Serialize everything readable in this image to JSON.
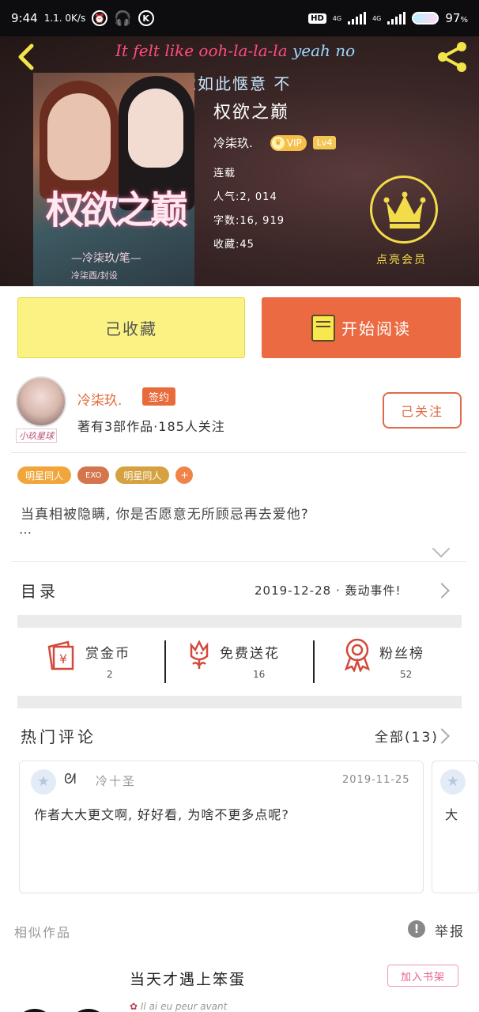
{
  "status_bar": {
    "time": "9:44",
    "net_speed": "1.1. 0K/s",
    "hd": "HD",
    "net1": "4G",
    "net2": "4G",
    "battery": "97",
    "battery_unit": "%"
  },
  "header": {
    "lyric_part1": "It felt like ooh-la-la-la ",
    "lyric_part2": "yeah no",
    "lyric_line2": "这感觉如此惬意 不",
    "book_title": "权欲之巅",
    "author_name": "冷柒玖.",
    "vip_label": "VIP",
    "level_label": "Lv4",
    "status": "连载",
    "popularity": "人气:2, 014",
    "word_count": "字数:16, 919",
    "favorites": "收藏:45",
    "member_label": "点亮会员",
    "cover": {
      "title": "权欲之巅",
      "author": "—冷柒玖/笔—",
      "designer": "冷柒酉/封设"
    }
  },
  "actions": {
    "collected_label": "己收藏",
    "read_label": "开始阅读"
  },
  "author": {
    "avatar_tag": "小玖星球",
    "name": "冷柒玖.",
    "sign_badge": "签约",
    "stats": "著有3部作品·185人关注",
    "follow_label": "己关注"
  },
  "tags": [
    "明星同人",
    "EXO",
    "明星同人",
    "+"
  ],
  "description": "当真相被隐瞒, 你是否愿意无所顾忌再去爱他?",
  "description_more": "…",
  "toc": {
    "label": "目录",
    "latest": "2019-12-28 · 轰动事件!"
  },
  "stats": [
    {
      "icon": "reward-coin-icon",
      "label": "赏金币",
      "value": "2"
    },
    {
      "icon": "flower-icon",
      "label": "免费送花",
      "value": "16"
    },
    {
      "icon": "fan-rank-icon",
      "label": "粉丝榜",
      "value": "52"
    }
  ],
  "comments": {
    "title": "热门评论",
    "all_label": "全部(13)",
    "items": [
      {
        "user": "冷十圣",
        "date": "2019-11-25",
        "text": "作者大大更文啊, 好好看, 为啥不更多点呢?"
      },
      {
        "text": "大"
      }
    ]
  },
  "similar": {
    "label": "相似作品",
    "report_label": "举报",
    "item_title": "当天才遇上笨蛋",
    "add_shelf_label": "加入书架",
    "item_sub": "Il ai eu peur avant"
  },
  "colors": {
    "accent_orange": "#ec6a42",
    "collected_yellow": "#faf282",
    "member_gold": "#f3dc4a"
  }
}
